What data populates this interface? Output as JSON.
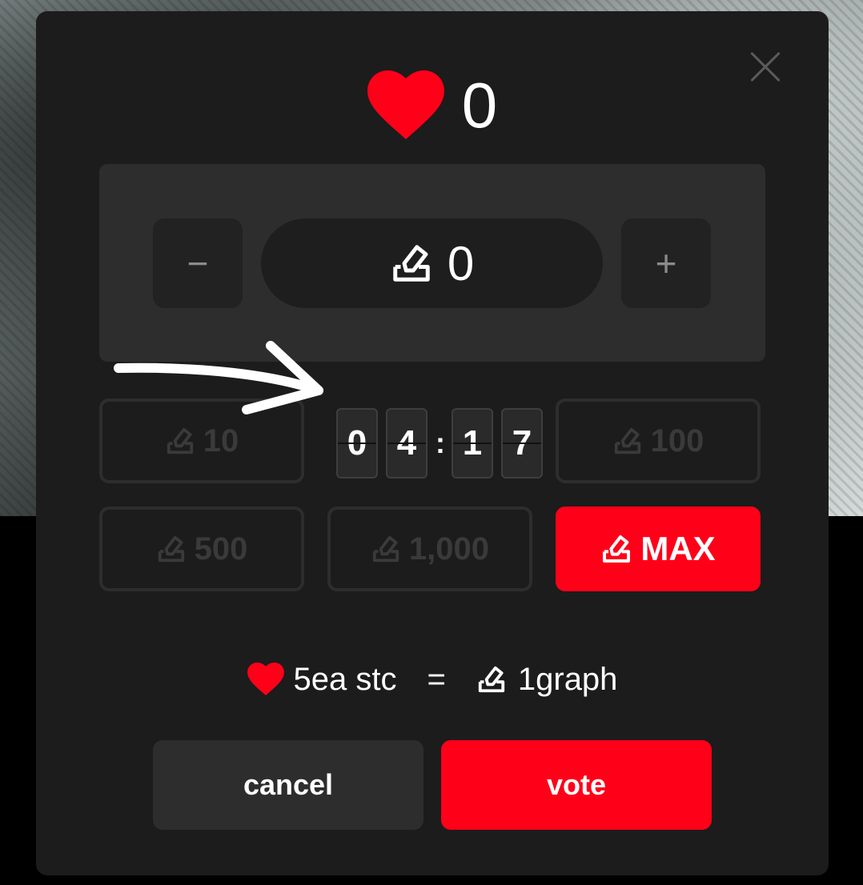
{
  "header": {
    "heart_count": "0"
  },
  "stepper": {
    "minus": "−",
    "plus": "+",
    "amount": "0"
  },
  "presets": [
    {
      "label": "10"
    },
    {
      "label": "100"
    },
    {
      "label": "500"
    },
    {
      "label": "1,000"
    },
    {
      "label": "MAX"
    }
  ],
  "timer": {
    "d1": "0",
    "d2": "4",
    "d3": "1",
    "d4": "7",
    "sep": ":"
  },
  "rate": {
    "left": "5ea stc",
    "eq": "=",
    "right": "1graph"
  },
  "actions": {
    "cancel": "cancel",
    "vote": "vote"
  },
  "colors": {
    "accent": "#ff0019",
    "modal_bg": "#1c1c1c",
    "panel_bg": "#2d2d2d"
  }
}
